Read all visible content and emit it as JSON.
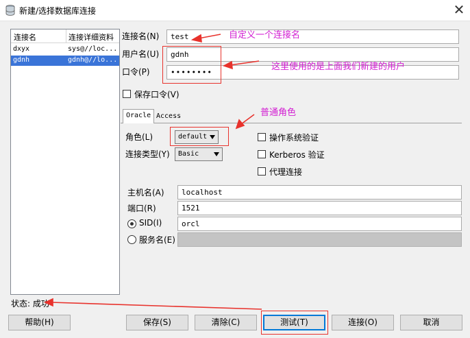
{
  "window": {
    "title": "新建/选择数据库连接",
    "close_glyph": "✕"
  },
  "connections": {
    "columns": [
      "连接名",
      "连接详细资料"
    ],
    "rows": [
      {
        "name": "dxyx",
        "detail": "sys@//loc...",
        "selected": false
      },
      {
        "name": "gdnh",
        "detail": "gdnh@//lo...",
        "selected": true
      }
    ]
  },
  "form": {
    "conn_name_label": "连接名(N)",
    "conn_name_value": "test",
    "username_label": "用户名(U)",
    "username_value": "gdnh",
    "password_label": "口令(P)",
    "password_value": "••••••••",
    "save_password_label": "保存口令(V)"
  },
  "tabs": {
    "oracle": "Oracle",
    "access": "Access"
  },
  "oracle": {
    "role_label": "角色(L)",
    "role_value": "default",
    "conn_type_label": "连接类型(Y)",
    "conn_type_value": "Basic",
    "os_auth_label": "操作系统验证",
    "kerberos_label": "Kerberos 验证",
    "proxy_label": "代理连接",
    "hostname_label": "主机名(A)",
    "hostname_value": "localhost",
    "port_label": "端口(R)",
    "port_value": "1521",
    "sid_label": "SID(I)",
    "sid_value": "orcl",
    "service_label": "服务名(E)"
  },
  "status": {
    "text": "状态: 成功"
  },
  "buttons": {
    "help": "帮助(H)",
    "save": "保存(S)",
    "clear": "清除(C)",
    "test": "测试(T)",
    "connect": "连接(O)",
    "cancel": "取消"
  },
  "annotations": {
    "custom_name": "自定义一个连接名",
    "user_note": "这里使用的是上面我们新建的用户",
    "role_note": "普通角色"
  },
  "colors": {
    "annotation_red": "#e8322c",
    "annotation_magenta": "#d21ed2",
    "selection_blue": "#3a74d8"
  }
}
